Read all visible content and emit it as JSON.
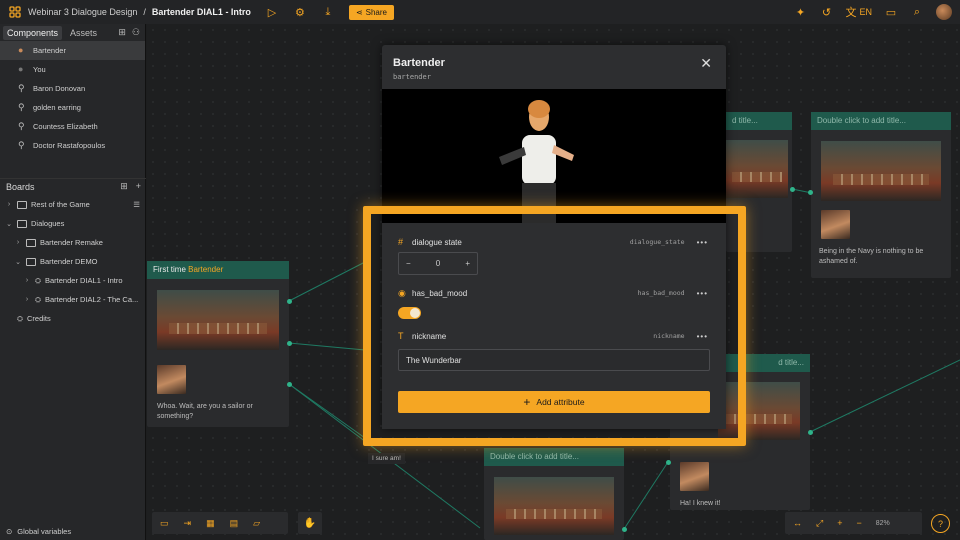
{
  "topbar": {
    "crumb_project": "Webinar 3 Dialogue Design",
    "crumb_sep": "/",
    "crumb_current": "Bartender DIAL1 - Intro",
    "share_label": "Share",
    "language": "EN"
  },
  "sidebar": {
    "tab_components": "Components",
    "tab_assets": "Assets",
    "components": [
      "Bartender",
      "You",
      "Baron Donovan",
      "golden earring",
      "Countess Elizabeth",
      "Doctor Rastafopoulos"
    ],
    "boards_label": "Boards",
    "tree": [
      {
        "label": "Rest of the Game",
        "indent": 0,
        "chev": "›",
        "icon": "folder"
      },
      {
        "label": "Dialogues",
        "indent": 0,
        "chev": "⌄",
        "icon": "folder"
      },
      {
        "label": "Bartender Remake",
        "indent": 1,
        "chev": "›",
        "icon": "folder"
      },
      {
        "label": "Bartender DEMO",
        "indent": 1,
        "chev": "⌄",
        "icon": "folder"
      },
      {
        "label": "Bartender DIAL1 - Intro",
        "indent": 2,
        "chev": "›",
        "icon": "board"
      },
      {
        "label": "Bartender DIAL2 - The Ca...",
        "indent": 2,
        "chev": "›",
        "icon": "board"
      },
      {
        "label": "Credits",
        "indent": 0,
        "chev": "",
        "icon": "board"
      }
    ],
    "global_variables": "Global variables"
  },
  "canvas": {
    "node_first_prefix": "First time ",
    "node_first_name": "Bartender",
    "node_first_text": "Whoa. Wait, are you a sailor or something?",
    "node_right_title": "Double click to add title...",
    "node_right_text": "Being in the Navy is nothing to be ashamed of.",
    "node_mid_title": "Double click to add title...",
    "node_br_text": "Ha! I knew it!",
    "label_sure": "I sure am!",
    "partial_title_1": "d title...",
    "partial_title_2": "d title...",
    "zoom": "82%"
  },
  "modal": {
    "title": "Bartender",
    "subtitle": "bartender",
    "attributes": [
      {
        "icon": "#",
        "name": "dialogue state",
        "key": "dialogue_state",
        "value": "0"
      },
      {
        "icon": "◉",
        "name": "has_bad_mood",
        "key": "has_bad_mood",
        "value": "true"
      },
      {
        "icon": "T",
        "name": "nickname",
        "key": "nickname",
        "value": "The Wunderbar"
      }
    ],
    "add_attribute_label": "Add attribute"
  },
  "colors": {
    "accent": "#f5a623",
    "node_header": "#1f5a4c",
    "connector": "#2fb38a"
  }
}
